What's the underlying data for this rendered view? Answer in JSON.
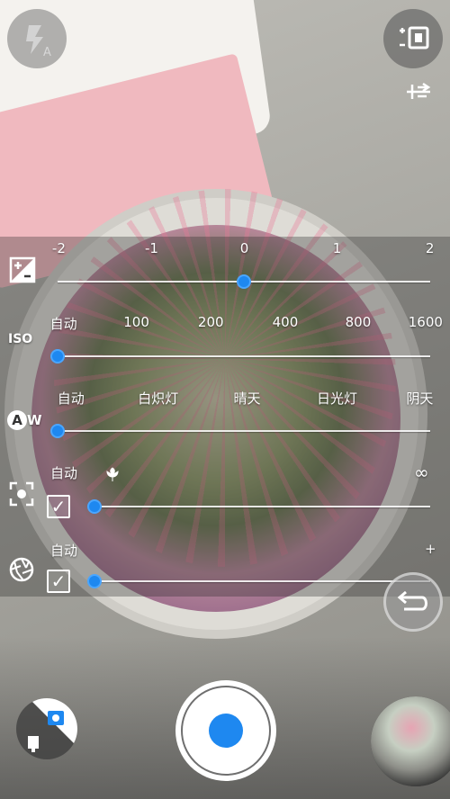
{
  "exposure": {
    "ticks": [
      "-2",
      "-1",
      "0",
      "1",
      "2"
    ],
    "value": 0
  },
  "iso": {
    "label": "ISO",
    "ticks": [
      "自动",
      "100",
      "200",
      "400",
      "800",
      "1600"
    ],
    "value": "自动"
  },
  "white_balance": {
    "icon_letter": "A",
    "icon_suffix": "W",
    "ticks": [
      "自动",
      "白炽灯",
      "晴天",
      "日光灯",
      "阴天"
    ],
    "value": "自动"
  },
  "focus": {
    "auto_label": "自动",
    "infinity_label": "∞",
    "auto_checked": true
  },
  "shutter_speed": {
    "auto_label": "自动",
    "plus_label": "+",
    "auto_checked": true
  },
  "icons": {
    "flash": "flash-auto-icon",
    "camera_switch": "switch-camera-icon",
    "settings_more": "tuning-icon",
    "exposure": "exposure-icon",
    "focus": "focus-icon",
    "aperture": "aperture-icon",
    "back": "back-arrow-icon",
    "mode": "photo-video-mode-icon"
  },
  "colors": {
    "accent": "#1e88f0",
    "text": "#ffffff"
  }
}
